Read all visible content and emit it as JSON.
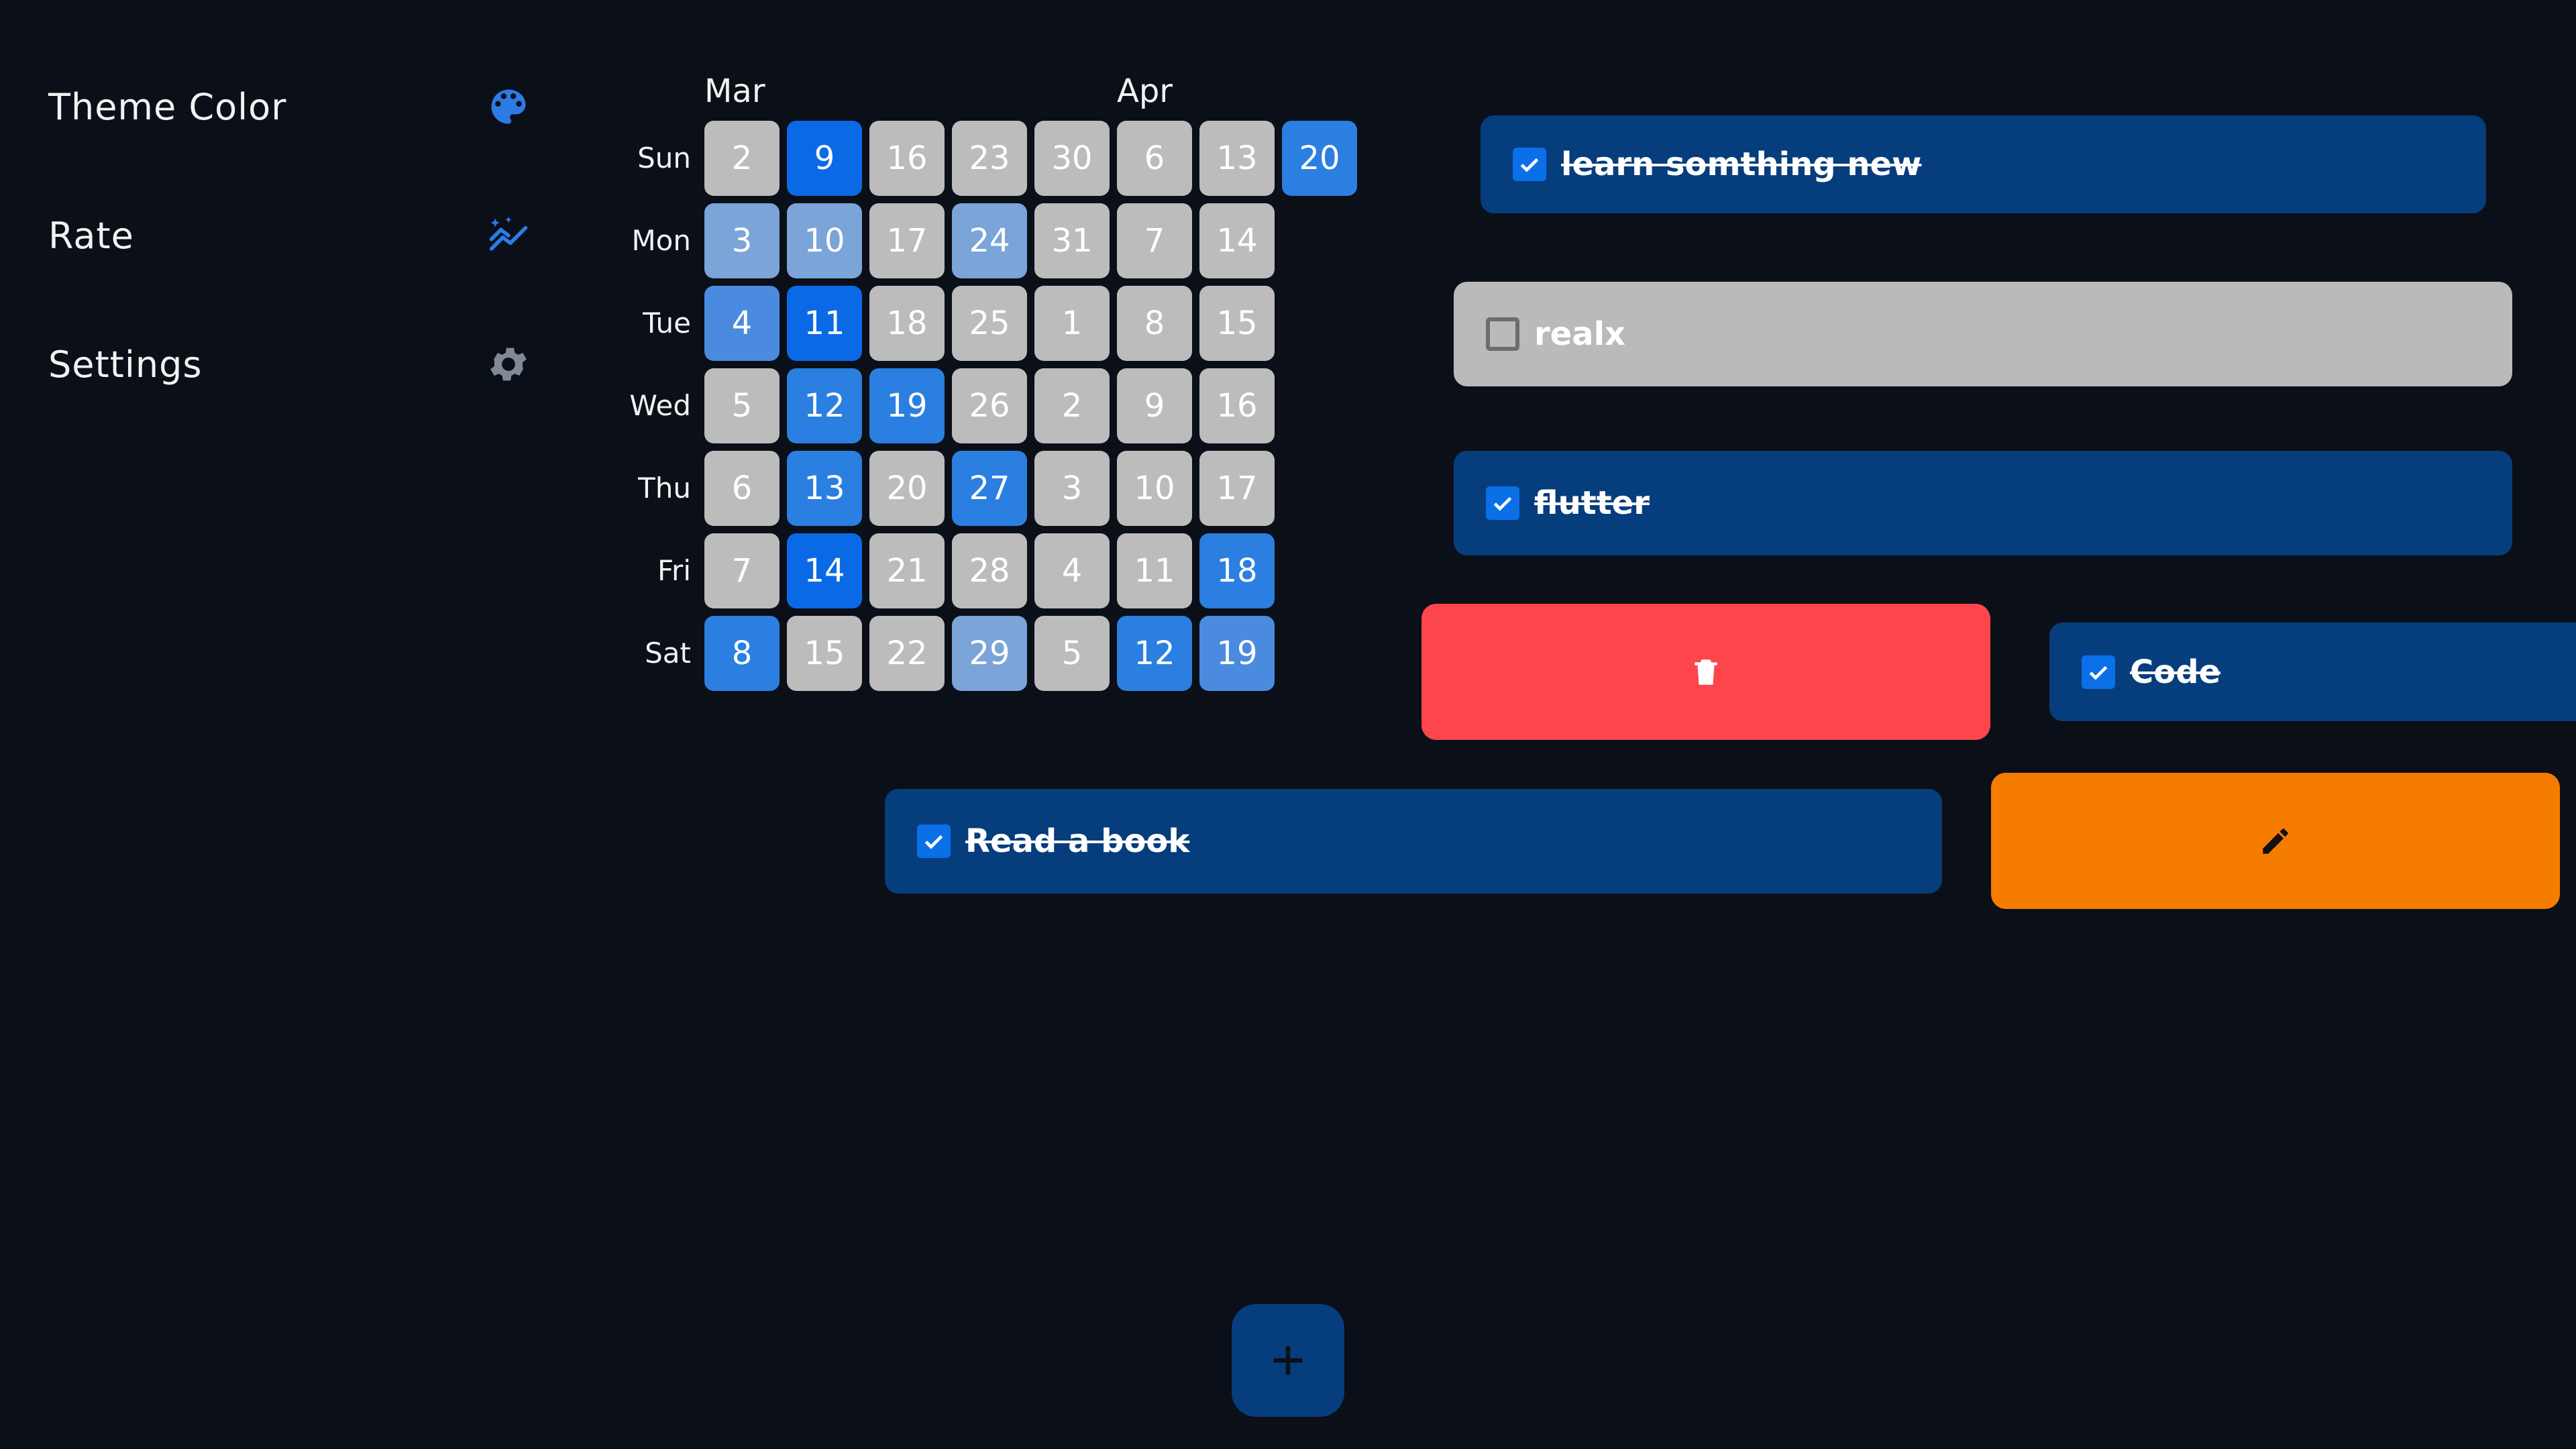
{
  "sidebar": {
    "items": [
      {
        "label": "Theme Color",
        "icon": "palette-icon"
      },
      {
        "label": "Rate",
        "icon": "sparkle-chart-icon"
      },
      {
        "label": "Settings",
        "icon": "gear-icon"
      }
    ],
    "icon_color": "#2c7be5"
  },
  "heatmap": {
    "months": [
      "Mar",
      "Apr"
    ],
    "weekdays": [
      "Sun",
      "Mon",
      "Tue",
      "Wed",
      "Thu",
      "Fri",
      "Sat"
    ],
    "colors": {
      "none": "#bcbcbc",
      "light": "#7ba4d8",
      "medium": "#4a8be0",
      "strong": "#2a7fe0",
      "full": "#0a6ae6"
    },
    "columns": [
      [
        {
          "day": "2",
          "level": "none"
        },
        {
          "day": "3",
          "level": "light"
        },
        {
          "day": "4",
          "level": "medium"
        },
        {
          "day": "5",
          "level": "none"
        },
        {
          "day": "6",
          "level": "none"
        },
        {
          "day": "7",
          "level": "none"
        },
        {
          "day": "8",
          "level": "strong"
        }
      ],
      [
        {
          "day": "9",
          "level": "full"
        },
        {
          "day": "10",
          "level": "light"
        },
        {
          "day": "11",
          "level": "full"
        },
        {
          "day": "12",
          "level": "strong"
        },
        {
          "day": "13",
          "level": "strong"
        },
        {
          "day": "14",
          "level": "full"
        },
        {
          "day": "15",
          "level": "none"
        }
      ],
      [
        {
          "day": "16",
          "level": "none"
        },
        {
          "day": "17",
          "level": "none"
        },
        {
          "day": "18",
          "level": "none"
        },
        {
          "day": "19",
          "level": "strong"
        },
        {
          "day": "20",
          "level": "none"
        },
        {
          "day": "21",
          "level": "none"
        },
        {
          "day": "22",
          "level": "none"
        }
      ],
      [
        {
          "day": "23",
          "level": "none"
        },
        {
          "day": "24",
          "level": "light"
        },
        {
          "day": "25",
          "level": "none"
        },
        {
          "day": "26",
          "level": "none"
        },
        {
          "day": "27",
          "level": "strong"
        },
        {
          "day": "28",
          "level": "none"
        },
        {
          "day": "29",
          "level": "light"
        }
      ],
      [
        {
          "day": "30",
          "level": "none"
        },
        {
          "day": "31",
          "level": "none"
        },
        {
          "day": "1",
          "level": "none"
        },
        {
          "day": "2",
          "level": "none"
        },
        {
          "day": "3",
          "level": "none"
        },
        {
          "day": "4",
          "level": "none"
        },
        {
          "day": "5",
          "level": "none"
        }
      ],
      [
        {
          "day": "6",
          "level": "none"
        },
        {
          "day": "7",
          "level": "none"
        },
        {
          "day": "8",
          "level": "none"
        },
        {
          "day": "9",
          "level": "none"
        },
        {
          "day": "10",
          "level": "none"
        },
        {
          "day": "11",
          "level": "none"
        },
        {
          "day": "12",
          "level": "strong"
        }
      ],
      [
        {
          "day": "13",
          "level": "none"
        },
        {
          "day": "14",
          "level": "none"
        },
        {
          "day": "15",
          "level": "none"
        },
        {
          "day": "16",
          "level": "none"
        },
        {
          "day": "17",
          "level": "none"
        },
        {
          "day": "18",
          "level": "strong"
        },
        {
          "day": "19",
          "level": "medium"
        }
      ],
      [
        {
          "day": "20",
          "level": "strong"
        }
      ]
    ]
  },
  "tasks": [
    {
      "label": "learn somthing new",
      "checked": true
    },
    {
      "label": "realx",
      "checked": false
    },
    {
      "label": "flutter",
      "checked": true
    },
    {
      "label": "Code",
      "checked": true
    },
    {
      "label": "Read a book",
      "checked": true
    }
  ],
  "actions": {
    "delete": {
      "icon": "trash-icon",
      "color": "#fc464b"
    },
    "edit": {
      "icon": "pencil-icon",
      "color": "#f67c00"
    }
  },
  "fab": {
    "icon": "plus-icon",
    "color": "#063d7d"
  }
}
